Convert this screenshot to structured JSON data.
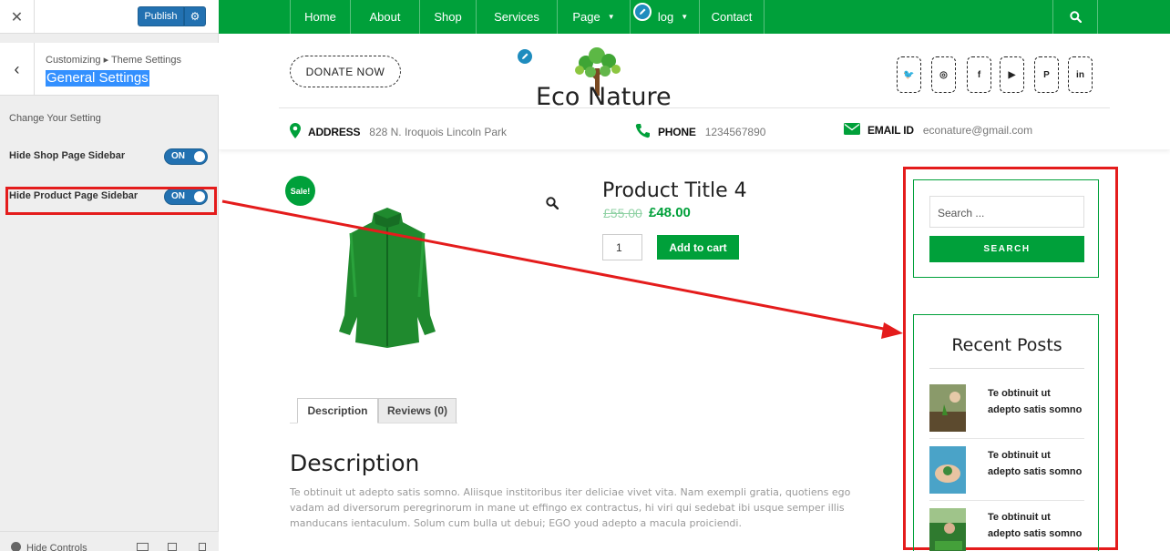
{
  "customizer": {
    "close_icon": "close-icon",
    "publish_label": "Publish",
    "publish_settings_icon": "gear-icon",
    "back_icon": "chevron-left-icon",
    "breadcrumb": "Customizing ▸ Theme Settings",
    "section_title": "General Settings",
    "description": "Change Your Setting",
    "settings": [
      {
        "label": "Hide Shop Page Sidebar",
        "state": "ON"
      },
      {
        "label": "Hide Product Page Sidebar",
        "state": "ON"
      }
    ],
    "hide_controls_label": "Hide Controls",
    "device_icons": [
      "desktop-icon",
      "tablet-icon",
      "mobile-icon"
    ]
  },
  "site": {
    "nav": [
      {
        "label": "Home"
      },
      {
        "label": "About"
      },
      {
        "label": "Shop"
      },
      {
        "label": "Services"
      },
      {
        "label": "Page",
        "has_dropdown": true
      },
      {
        "label": "log",
        "has_dropdown": true
      },
      {
        "label": "Contact"
      }
    ],
    "nav_search_icon": "search-icon",
    "donate_label": "DONATE NOW",
    "logo_text": "Eco Nature",
    "social_icons": [
      "twitter-icon",
      "instagram-icon",
      "facebook-icon",
      "youtube-icon",
      "pinterest-icon",
      "linkedin-icon"
    ],
    "contact_info": {
      "address_label": "ADDRESS",
      "address_value": "828 N. Iroquois Lincoln Park",
      "phone_label": "PHONE",
      "phone_value": "1234567890",
      "email_label": "EMAIL ID",
      "email_value": "econature@gmail.com"
    },
    "brand_color": "#00a03a",
    "highlight_color": "#e41c1c"
  },
  "product": {
    "sale_badge": "Sale!",
    "title": "Product Title 4",
    "price_old": "£55.00",
    "price_new": "£48.00",
    "quantity": "1",
    "add_to_cart": "Add to cart",
    "tabs": [
      "Description",
      "Reviews (0)"
    ],
    "description_heading": "Description",
    "description_text": "Te obtinuit ut adepto satis somno. Aliisque institoribus iter deliciae vivet vita. Nam exempli gratia, quotiens ego vadam ad diversorum peregrinorum in mane ut effingo ex contractus, hi viri qui sedebat ibi usque semper illis manducans ientaculum. Solum cum bulla ut debui; EGO youd adepto a macula proiciendi."
  },
  "sidebar": {
    "search_placeholder": "Search ...",
    "search_button": "SEARCH",
    "recent_posts_title": "Recent Posts",
    "posts": [
      {
        "line1": "Te obtinuit ut",
        "line2": "adepto satis somno"
      },
      {
        "line1": "Te obtinuit ut",
        "line2": "adepto satis somno"
      },
      {
        "line1": "Te obtinuit ut",
        "line2": "adepto satis somno"
      }
    ]
  }
}
